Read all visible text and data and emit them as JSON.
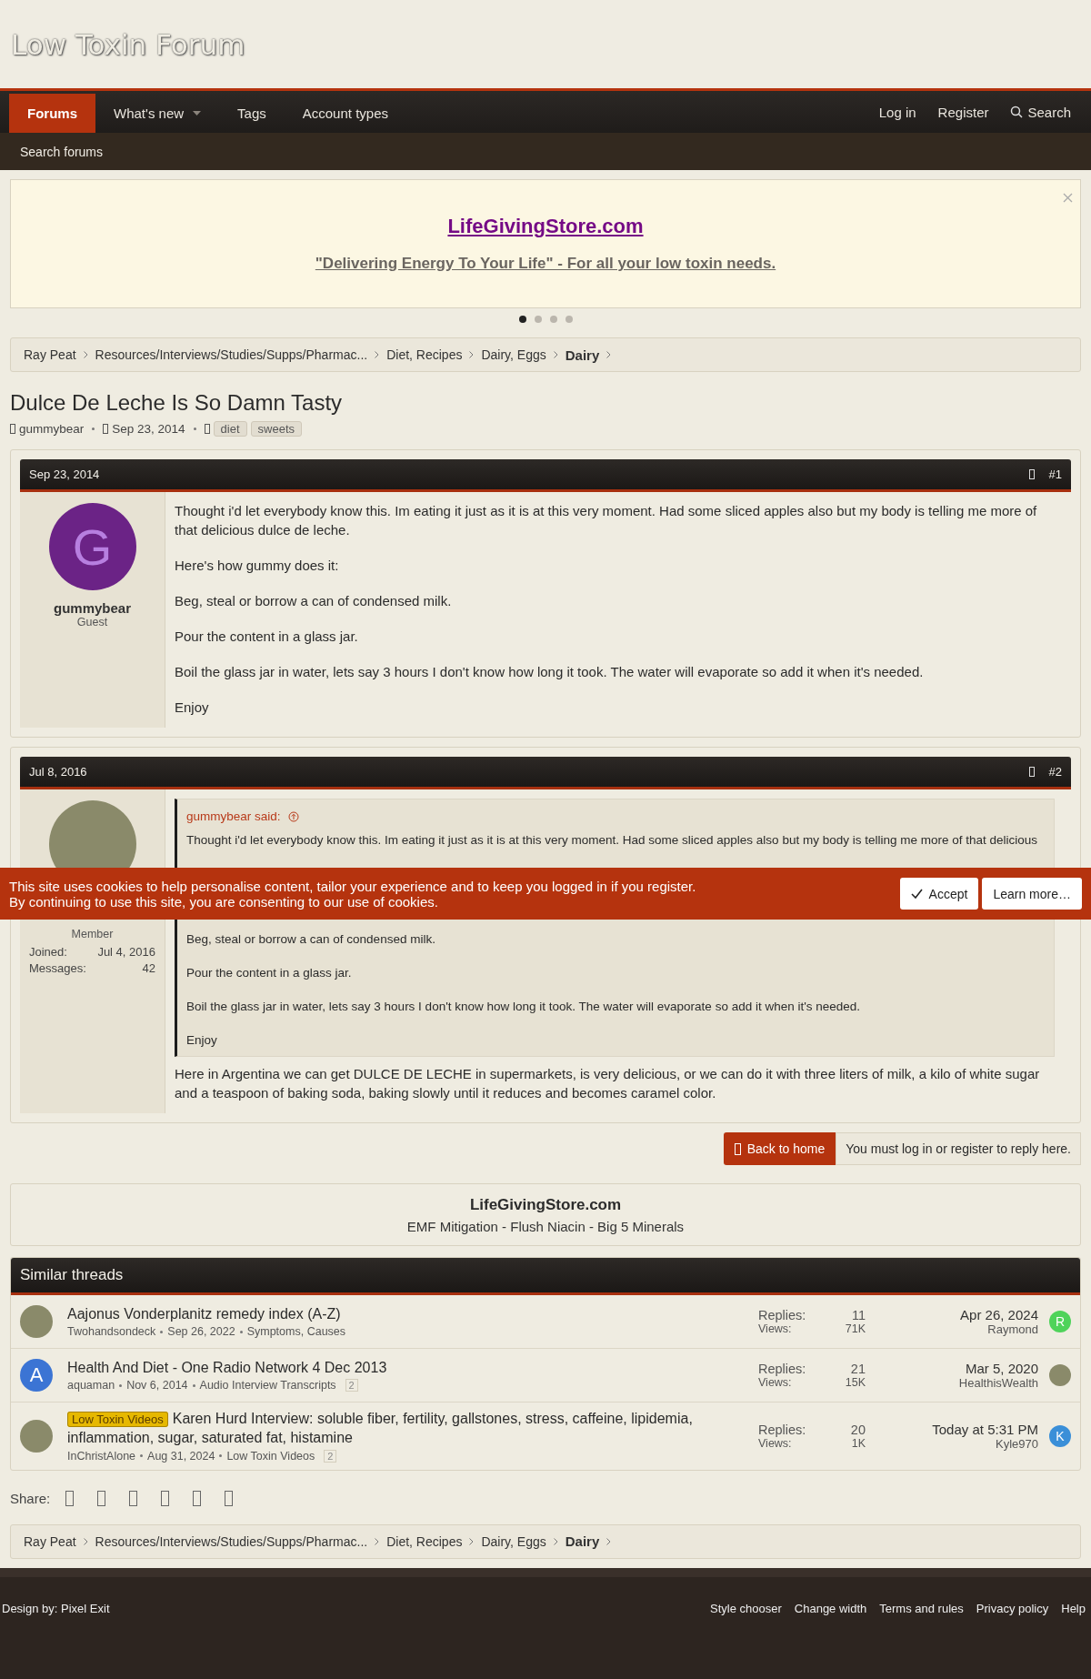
{
  "header": {
    "logo": "Low Toxin Forum"
  },
  "nav": {
    "tabs": [
      {
        "label": "Forums",
        "selected": true,
        "dropdown": false
      },
      {
        "label": "What's new",
        "selected": false,
        "dropdown": true
      },
      {
        "label": "Tags",
        "selected": false,
        "dropdown": false
      },
      {
        "label": "Account types",
        "selected": false,
        "dropdown": false
      }
    ],
    "links": [
      "Log in",
      "Register"
    ],
    "search": "Search"
  },
  "subnav": {
    "items": [
      "Search forums"
    ]
  },
  "ad": {
    "title": "LifeGivingStore.com",
    "tagline": "\"Delivering Energy To Your Life\" - For all your low toxin needs.",
    "dots": [
      {
        "selected": true
      },
      {
        "selected": false
      },
      {
        "selected": false
      },
      {
        "selected": false
      }
    ]
  },
  "breadcrumbs_top": [
    {
      "label": "Ray Peat",
      "current": false
    },
    {
      "label": "Resources/Interviews/Studies/Supps/Pharmac...",
      "current": false
    },
    {
      "label": "Diet, Recipes",
      "current": false
    },
    {
      "label": "Dairy, Eggs",
      "current": false
    },
    {
      "label": "Dairy",
      "current": true
    }
  ],
  "thread": {
    "title": "Dulce De Leche Is So Damn Tasty",
    "author": "gummybear",
    "date": "Sep 23, 2014",
    "tags": [
      "diet",
      "sweets"
    ]
  },
  "posts": [
    {
      "date": "Sep 23, 2014",
      "number": "#1",
      "user": {
        "name": "gummybear",
        "title": "Guest",
        "avatar": {
          "kind": "letter",
          "letter": "G",
          "color": "#6b2386"
        }
      },
      "paragraphs": [
        "Thought i'd let everybody know this. Im eating it just as it is at this very moment. Had some sliced apples also but my body is telling me more of that delicious dulce de leche.",
        "Here's how gummy does it:",
        "Beg, steal or borrow a can of condensed milk.",
        "Pour the content in a glass jar.",
        "Boil the glass jar in water, lets say 3 hours I don't know how long it took. The water will evaporate so add it when it's needed.",
        "Enjoy"
      ]
    },
    {
      "date": "Jul 8, 2016",
      "number": "#2",
      "user": {
        "title": "Member",
        "avatar": {
          "kind": "photo"
        },
        "stats": [
          {
            "label": "Joined:",
            "value": "Jul 4, 2016"
          },
          {
            "label": "Messages:",
            "value": "42"
          }
        ]
      },
      "quote": {
        "author": "gummybear said:",
        "paragraphs": [
          "Thought i'd let everybody know this. Im eating it just as it is at this very moment. Had some sliced apples also but my body is telling me more of that delicious",
          "Beg, steal or borrow a can of condensed milk.",
          "Pour the content in a glass jar.",
          "Boil the glass jar in water, lets say 3 hours I don't know how long it took. The water will evaporate so add it when it's needed.",
          "Enjoy"
        ]
      },
      "paragraphs": [
        "Here in Argentina we can get DULCE DE LECHE in supermarkets, is very delicious, or we can do it with three liters of milk, a kilo of white sugar and a teaspoon of baking soda, baking slowly until it reduces and becomes caramel color."
      ]
    }
  ],
  "cookie_notice": {
    "lines": [
      "This site uses cookies to help personalise content, tailor your experience and to keep you logged in if you register.",
      "By continuing to use this site, you are consenting to our use of cookies."
    ],
    "buttons": [
      {
        "label": "Accept",
        "kind": "accept"
      },
      {
        "label": "Learn more…",
        "kind": "link"
      }
    ]
  },
  "actions": {
    "back": "Back to home",
    "notice": "You must log in or register to reply here."
  },
  "store_box": {
    "title": "LifeGivingStore.com",
    "subtitle": "EMF Mitigation - Flush Niacin - Big 5 Minerals"
  },
  "similar_threads": {
    "title": "Similar threads",
    "threads": [
      {
        "avatar": {
          "kind": "photo"
        },
        "title": "Aajonus Vonderplanitz remedy index (A-Z)",
        "author": "Twohandsondeck",
        "date": "Sep 26, 2022",
        "forum": "Symptoms, Causes",
        "replies_label": "Replies:",
        "replies": "11",
        "views_label": "Views:",
        "views": "71K",
        "last_date": "Apr 26, 2024",
        "last_user": "Raymond",
        "last_avatar": {
          "kind": "letter",
          "letter": "R",
          "color": "#4fd35a"
        }
      },
      {
        "avatar": {
          "kind": "letter",
          "letter": "A",
          "color": "#3b74d4"
        },
        "title": "Health And Diet - One Radio Network 4 Dec 2013",
        "author": "aquaman",
        "date": "Nov 6, 2014",
        "forum": "Audio Interview Transcripts",
        "pages": "2",
        "replies_label": "Replies:",
        "replies": "21",
        "views_label": "Views:",
        "views": "15K",
        "last_date": "Mar 5, 2020",
        "last_user": "HealthisWealth",
        "last_avatar": {
          "kind": "photo"
        }
      },
      {
        "avatar": {
          "kind": "photo"
        },
        "prefix": "Low Toxin Videos",
        "title": "Karen Hurd Interview: soluble fiber, fertility, gallstones, stress, caffeine, lipidemia, inflammation, sugar, saturated fat, histamine",
        "author": "InChristAlone",
        "date": "Aug 31, 2024",
        "forum": "Low Toxin Videos",
        "pages": "2",
        "replies_label": "Replies:",
        "replies": "20",
        "views_label": "Views:",
        "views": "1K",
        "last_date": "Today at 5:31 PM",
        "last_user": "Kyle970",
        "last_avatar": {
          "kind": "letter",
          "letter": "K",
          "color": "#3a8fd8"
        }
      }
    ]
  },
  "share": {
    "label": "Share:"
  },
  "breadcrumbs_bottom": [
    {
      "label": "Ray Peat",
      "current": false
    },
    {
      "label": "Resources/Interviews/Studies/Supps/Pharmac...",
      "current": false
    },
    {
      "label": "Diet, Recipes",
      "current": false
    },
    {
      "label": "Dairy, Eggs",
      "current": false
    },
    {
      "label": "Dairy",
      "current": true
    }
  ],
  "footer": {
    "credit": "Design by: Pixel Exit",
    "links": [
      "Style chooser",
      "Change width",
      "Terms and rules",
      "Privacy policy",
      "Help"
    ]
  }
}
